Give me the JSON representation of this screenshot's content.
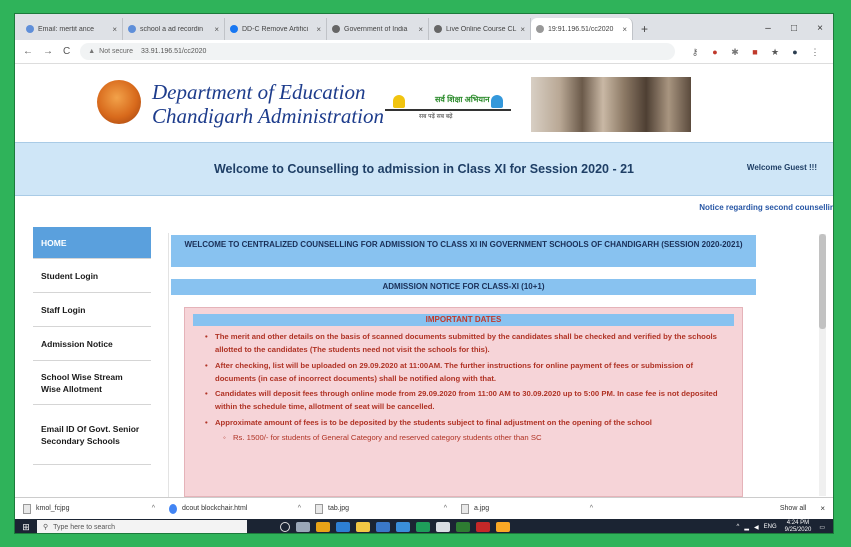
{
  "browser": {
    "tabs": [
      {
        "label": "Email: mertit ance",
        "active": false
      },
      {
        "label": "school a ad recordin",
        "active": false
      },
      {
        "label": "DD-C Remove Artifici",
        "active": false
      },
      {
        "label": "Government of India",
        "active": false
      },
      {
        "label": "Live Online Course CL",
        "active": false
      },
      {
        "label": "19:91.196.51/cc2020",
        "active": true
      }
    ],
    "new_tab": "+",
    "window_controls": {
      "minimize": "–",
      "maximize": "□",
      "close": "×"
    },
    "address": {
      "security": "Not secure",
      "url": "33.91.196.51/cc2020"
    },
    "nav": {
      "back": "←",
      "forward": "→",
      "reload": "C"
    }
  },
  "header": {
    "dept_line1": "Department of Education",
    "dept_line2": "Chandigarh Administration",
    "shiksha_label": "सर्व शिक्षा अभियान",
    "shiksha_sub": "सब पढ़ें सब बढ़ें"
  },
  "band": {
    "title": "Welcome to Counselling to admission in Class XI for Session 2020 - 21",
    "guest": "Welcome Guest !!!"
  },
  "marquee": "Notice regarding second counsellir",
  "sidebar": {
    "items": [
      {
        "label": "HOME"
      },
      {
        "label": "Student Login"
      },
      {
        "label": "Staff Login"
      },
      {
        "label": "Admission Notice"
      },
      {
        "label": "School Wise Stream Wise Allotment"
      },
      {
        "label": "Email ID Of Govt. Senior Secondary Schools"
      }
    ]
  },
  "main": {
    "notice1": "WELCOME TO CENTRALIZED COUNSELLING FOR ADMISSION TO CLASS XI IN GOVERNMENT SCHOOLS OF CHANDIGARH (SESSION 2020-2021)",
    "notice2": "ADMISSION NOTICE FOR CLASS-XI (10+1)",
    "dates_heading": "IMPORTANT DATES",
    "dates": [
      "The merit and other details on the basis of scanned documents submitted by the candidates shall be checked and verified by the schools allotted to the candidates (The students need not visit the schools for this).",
      "After checking, list will be uploaded on 29.09.2020 at 11:00AM. The further instructions for online payment of fees or submission of documents (in case of incorrect documents) shall be notified along with that.",
      "Candidates will deposit fees through online mode from 29.09.2020 from 11:00 AM to 30.09.2020 up to 5:00 PM. In case fee is not deposited within the schedule time, allotment of seat will be cancelled.",
      "Approximate amount of fees is to be deposited by the students subject to final adjustment on the opening of the school"
    ],
    "sub_item": "Rs. 1500/- for students of General Category and reserved category students other than SC"
  },
  "downloads": {
    "items": [
      {
        "name": "kmol_fcjpg"
      },
      {
        "name": "dcout blockchair.html"
      },
      {
        "name": "tab.jpg"
      },
      {
        "name": "a.jpg"
      }
    ],
    "show_all": "Show all",
    "close": "×"
  },
  "taskbar": {
    "search_placeholder": "Type here to search",
    "time": "4:24 PM",
    "date": "9/25/2020",
    "lang": "ENG"
  },
  "colors": {
    "frame_green": "#2fb35a",
    "band_blue": "#cfe6f7",
    "notice_blue": "#88c2f0",
    "dates_pink": "#f6d4d8",
    "dates_text": "#b03325",
    "home_blue": "#5aa0dd"
  }
}
